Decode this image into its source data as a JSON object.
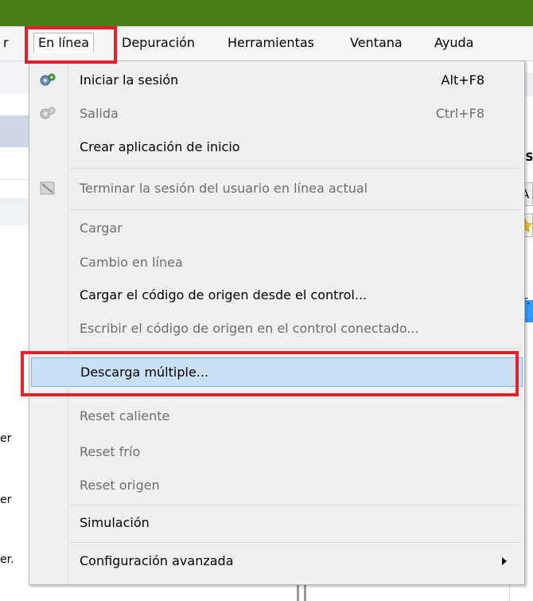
{
  "colors": {
    "titlebar": "#4a7f17",
    "highlight": "#e4202a",
    "selected_bg": "#c9e0f7"
  },
  "menubar": {
    "partial_left": "r",
    "items": [
      "En línea",
      "Depuración",
      "Herramientas",
      "Ventana",
      "Ayuda"
    ]
  },
  "menu": {
    "items": {
      "iniciar": {
        "label": "Iniciar la sesión",
        "shortcut": "Alt+F8",
        "icon": "connect-gear-icon"
      },
      "salida": {
        "label": "Salida",
        "shortcut": "Ctrl+F8",
        "icon": "disconnect-gear-icon"
      },
      "crear": {
        "label": "Crear aplicación de inicio"
      },
      "terminar": {
        "label": "Terminar la sesión del usuario en línea actual",
        "icon": "terminate-session-icon"
      },
      "cargar": {
        "label": "Cargar"
      },
      "cambio": {
        "label": "Cambio en línea"
      },
      "cargar_codigo": {
        "label": "Cargar el código de origen desde el control..."
      },
      "escribir_codigo": {
        "label": "Escribir el código de origen en el control conectado..."
      },
      "descarga": {
        "label": "Descarga múltiple..."
      },
      "reset_caliente": {
        "label": "Reset caliente"
      },
      "reset_frio": {
        "label": "Reset frío"
      },
      "reset_origen": {
        "label": "Reset origen"
      },
      "simulacion": {
        "label": "Simulación"
      },
      "configuracion": {
        "label": "Configuración avanzada"
      }
    }
  },
  "background": {
    "left_texts": [
      "er",
      "er",
      "er."
    ],
    "right_texts": [
      "IIS",
      "A",
      "tr."
    ]
  }
}
